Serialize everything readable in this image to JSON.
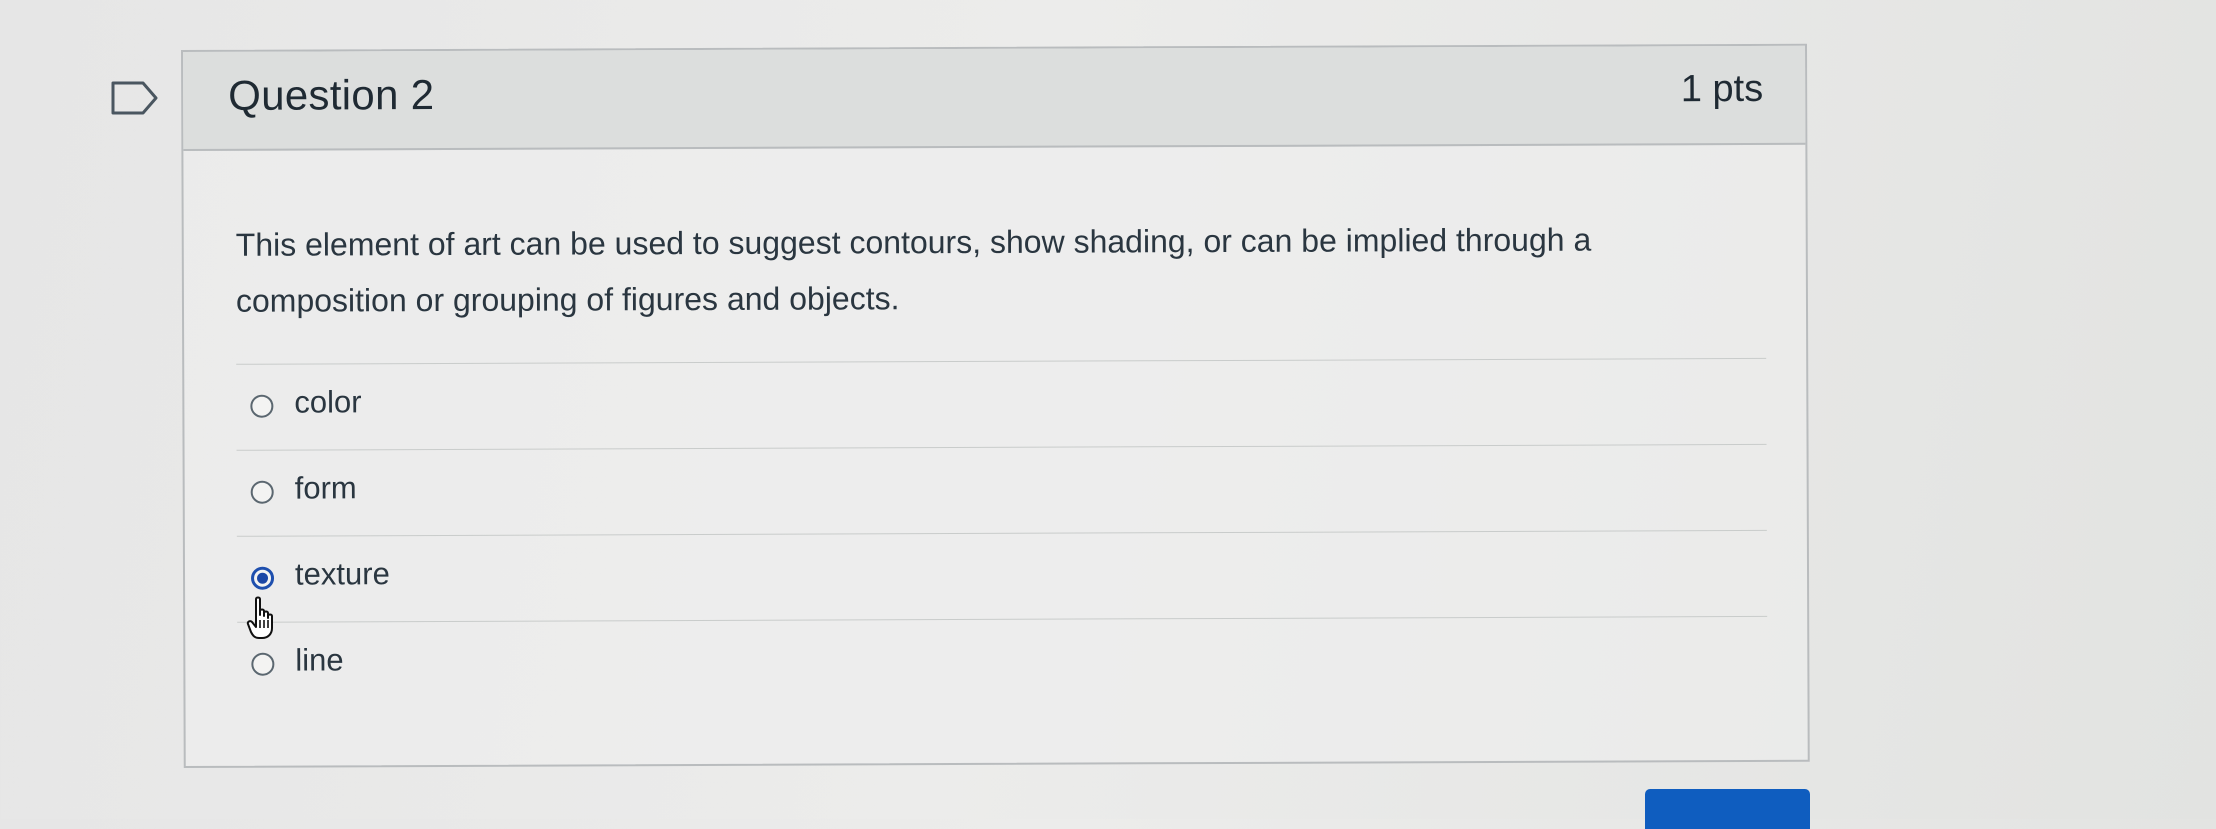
{
  "question": {
    "title": "Question 2",
    "points": "1 pts",
    "text": "This element of art can be used to suggest contours, show shading, or can be implied through a composition or grouping of figures and objects.",
    "flag_icon": "bookmark-flag-icon"
  },
  "answers": [
    {
      "label": "color",
      "selected": false
    },
    {
      "label": "form",
      "selected": false
    },
    {
      "label": "texture",
      "selected": true
    },
    {
      "label": "line",
      "selected": false
    }
  ],
  "colors": {
    "selected_radio": "#1b47a6",
    "button": "#0f5dbf",
    "header_bg": "#dcdedd"
  },
  "cursor_icon": "hand-pointer-icon"
}
